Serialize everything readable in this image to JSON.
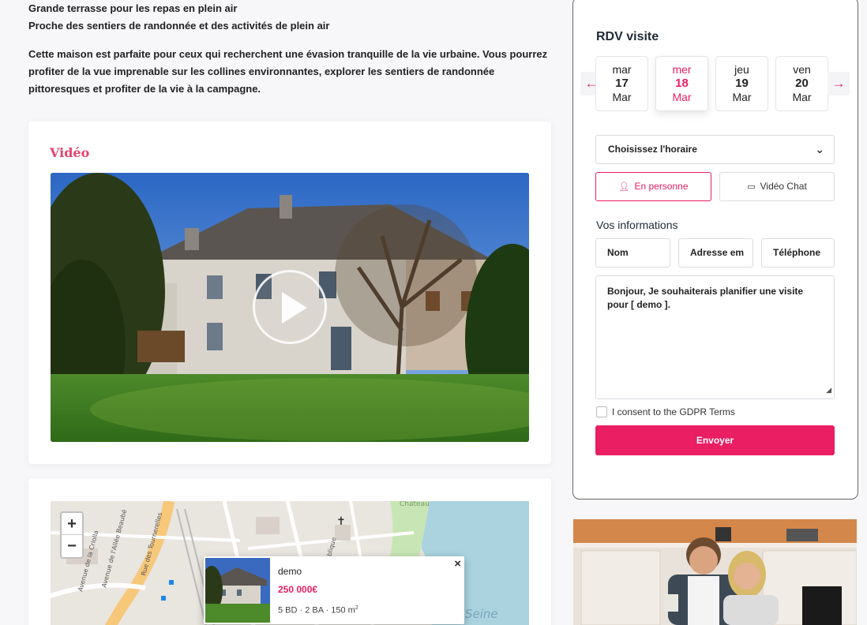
{
  "description": {
    "features": [
      "Grande terrasse pour les repas en plein air",
      "Proche des sentiers de randonnée et des activités de plein air"
    ],
    "paragraph": "Cette maison est parfaite pour ceux qui recherchent une évasion tranquille de la vie urbaine. Vous pourrez profiter de la vue imprenable sur les collines environnantes, explorer les sentiers de randonnée pittoresques et profiter de la vie à la campagne."
  },
  "video": {
    "title": "Vidéo"
  },
  "map": {
    "zoom_in": "+",
    "zoom_out": "−",
    "labels": [
      "Seine",
      "Château",
      "République",
      "Avenue de la Criolla",
      "Avenue de l'Allée Beaubé",
      "Rue des Tournerelles"
    ],
    "popup": {
      "title": "demo",
      "price": "250 000€",
      "specs": "5 BD · 2 BA · 150 m",
      "specs_sup": "2",
      "close": "×"
    }
  },
  "booking": {
    "title": "RDV visite",
    "prev_icon": "arrow-left-icon",
    "next_icon": "arrow-right-icon",
    "days": [
      {
        "name": "mar",
        "num": "17",
        "month": "Mar"
      },
      {
        "name": "mer",
        "num": "18",
        "month": "Mar"
      },
      {
        "name": "jeu",
        "num": "19",
        "month": "Mar"
      },
      {
        "name": "ven",
        "num": "20",
        "month": "Mar"
      }
    ],
    "active_day_index": 1,
    "time_select": "Choisissez l'horaire",
    "mode_person": "En personne",
    "mode_video": "Vidéo Chat",
    "info_title": "Vos informations",
    "name_placeholder": "Nom",
    "email_placeholder": "Adresse em",
    "phone_placeholder": "Téléphone",
    "message": "Bonjour, Je souhaiterais planifier une visite pour [ demo ].",
    "gdpr_label": "I consent to the GDPR Terms",
    "submit": "Envoyer"
  },
  "colors": {
    "accent": "#e91e63",
    "video_title": "#e5436a"
  }
}
